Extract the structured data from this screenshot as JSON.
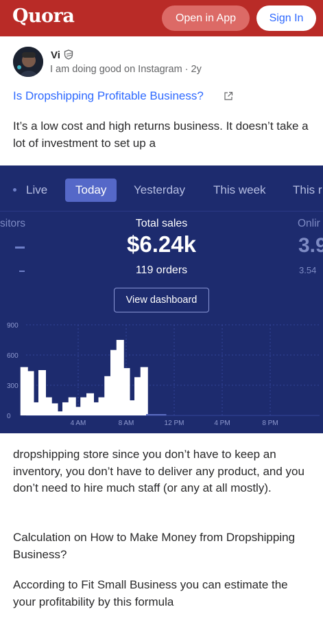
{
  "header": {
    "logo": "Quora",
    "open_in_app": "Open in App",
    "sign_in": "Sign In",
    "brand_color": "#b92b27",
    "link_color": "#2e69ff"
  },
  "author": {
    "name": "Vi",
    "credential": "I am doing good on Instagram · 2y"
  },
  "question": {
    "title": "Is Dropshipping Profitable Business?"
  },
  "answer": {
    "intro": "It’s a low cost and high returns business. It doesn’t take a lot of investment to set up a",
    "continuation": "dropshipping store since you don’t have to keep an inventory, you don’t have to deliver any product, and you don’t need to hire much staff (or any at all mostly).",
    "para2": "Calculation on How to Make Money from Dropshipping Business?",
    "para3": "According to Fit Small Business you can estimate the your profitability by this formula"
  },
  "dashboard": {
    "tabs": [
      "Live",
      "Today",
      "Yesterday",
      "This week",
      "This r"
    ],
    "active_tab": "Today",
    "left_label": "sitors",
    "total_label": "Total sales",
    "total_value": "$6.24k",
    "orders": "119 orders",
    "right_label": "Onlir",
    "right_value": "3.9",
    "right_sub": "3.54",
    "view_button": "View dashboard",
    "background": "#1d2b6e"
  },
  "chart_data": {
    "type": "bar",
    "title": "",
    "xlabel": "",
    "ylabel": "",
    "ylim": [
      0,
      900
    ],
    "yticks": [
      0,
      300,
      600,
      900
    ],
    "xticks": [
      "4 AM",
      "8 AM",
      "12 PM",
      "4 PM",
      "8 PM"
    ],
    "xtick_hours": [
      4,
      8,
      12,
      16,
      20
    ],
    "hours": [
      -0.5,
      0,
      0.5,
      1,
      1.5,
      2,
      2.5,
      3,
      3.5,
      4,
      4.5,
      5,
      5.5,
      6,
      6.5,
      7,
      7.5,
      8,
      8.5,
      9,
      9.5,
      10,
      10.5,
      11,
      11.5,
      12,
      12.5,
      13,
      13.5,
      14,
      14.5,
      15,
      15.5,
      16,
      16.5,
      17,
      17.5,
      18,
      18.5,
      19,
      19.5,
      20,
      20.5,
      21,
      21.5,
      22,
      22.5
    ],
    "values": [
      480,
      440,
      130,
      450,
      180,
      120,
      40,
      130,
      180,
      85,
      180,
      220,
      130,
      180,
      390,
      650,
      750,
      470,
      150,
      380,
      480,
      0,
      0,
      0
    ],
    "bar_color": "#ffffff",
    "grid": true
  }
}
